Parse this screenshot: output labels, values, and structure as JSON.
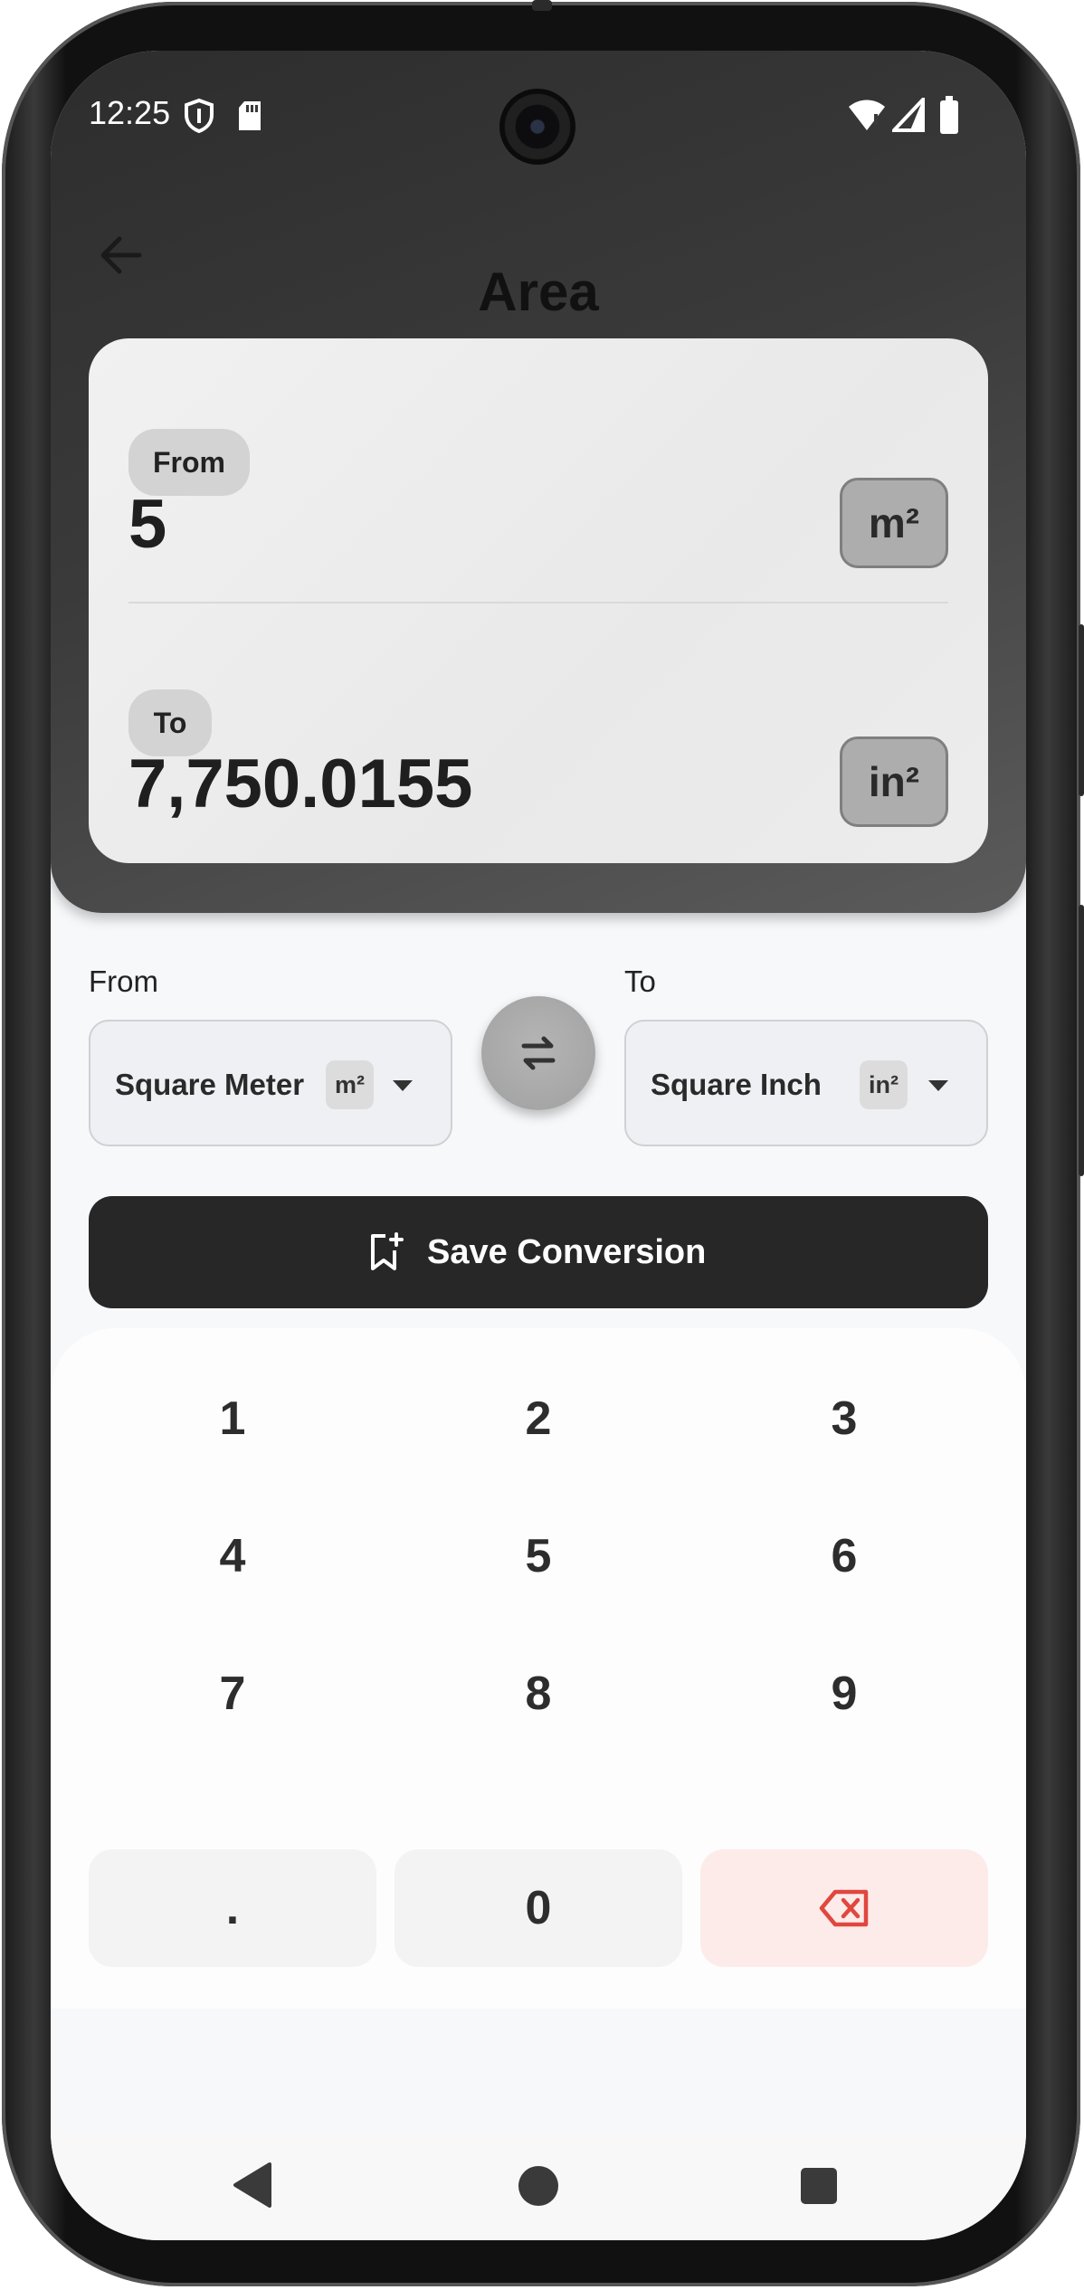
{
  "status_bar": {
    "time": "12:25"
  },
  "header": {
    "title": "Area"
  },
  "result_card": {
    "from_label": "From",
    "from_value": "5",
    "from_unit": "m²",
    "to_label": "To",
    "to_value": "7,750.0155",
    "to_unit": "in²"
  },
  "selectors": {
    "from_label": "From",
    "from_unit_name": "Square Meter",
    "from_unit_abbr": "m²",
    "to_label": "To",
    "to_unit_name": "Square Inch",
    "to_unit_abbr": "in²"
  },
  "save_button": {
    "label": "Save Conversion"
  },
  "keypad": {
    "keys": [
      "1",
      "2",
      "3",
      "4",
      "5",
      "6",
      "7",
      "8",
      "9",
      ".",
      "0"
    ]
  },
  "icons": {
    "back": "arrow-left-icon",
    "swap": "swap-arrows-icon",
    "save": "bookmark-add-icon",
    "backspace": "backspace-icon"
  },
  "colors": {
    "header_bg": "#3a3a3a",
    "save_bg": "#272727",
    "backspace_bg": "#fdebea",
    "backspace_icon": "#e0473e"
  }
}
